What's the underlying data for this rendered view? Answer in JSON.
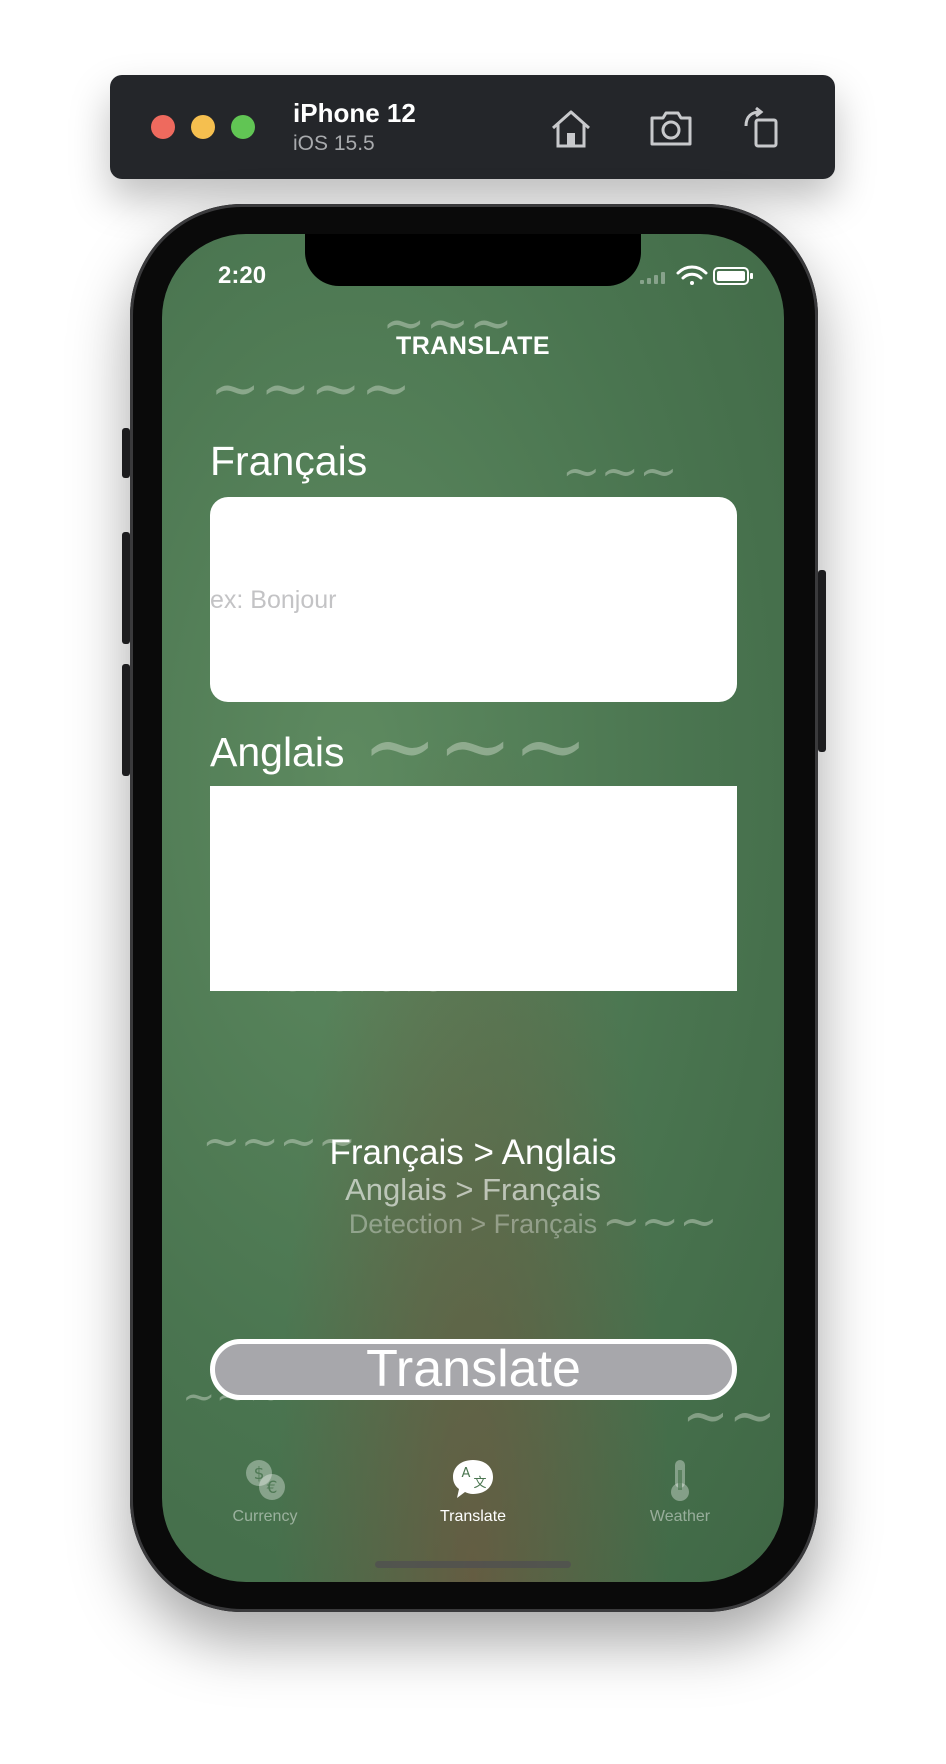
{
  "simulator": {
    "device_name": "iPhone 12",
    "os_version": "iOS 15.5",
    "toolbar_icons": [
      "home-icon",
      "screenshot-icon",
      "rotate-icon"
    ]
  },
  "status_bar": {
    "time": "2:20",
    "icons": [
      "wifi-icon",
      "battery-icon"
    ]
  },
  "nav": {
    "title": "TRANSLATE"
  },
  "source": {
    "label": "Français",
    "placeholder": "ex: Bonjour",
    "value": ""
  },
  "target": {
    "label": "Anglais",
    "value": ""
  },
  "language_picker": {
    "options": [
      "Français > Anglais",
      "Anglais > Français",
      "Detection > Français"
    ],
    "selected": "Français > Anglais"
  },
  "translate_button": {
    "label": "Translate"
  },
  "tab_bar": {
    "tabs": [
      {
        "label": "Currency",
        "icon": "currency-icon",
        "active": false
      },
      {
        "label": "Translate",
        "icon": "translate-icon",
        "active": true
      },
      {
        "label": "Weather",
        "icon": "thermometer-icon",
        "active": false
      }
    ]
  },
  "colors": {
    "background_green": "#4a7550",
    "button_gray": "#a7a7ab",
    "placeholder_gray": "#c3c3c5"
  }
}
